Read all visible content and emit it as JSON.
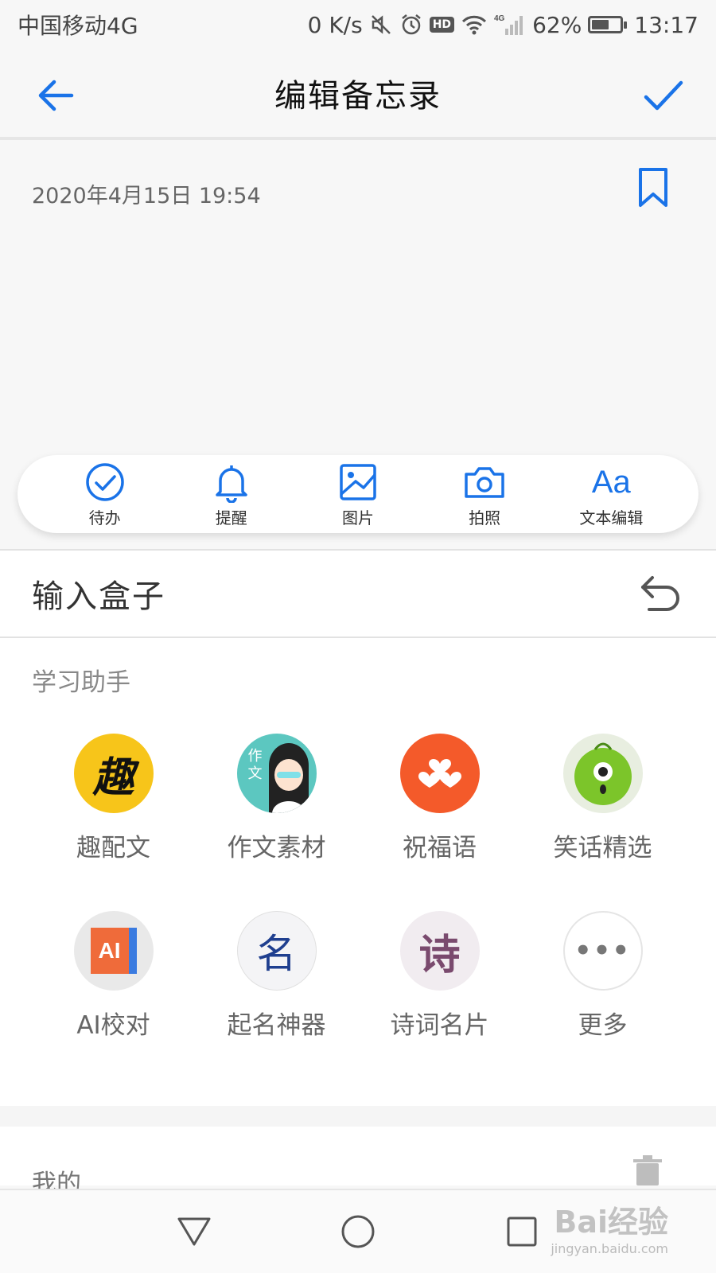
{
  "status_bar": {
    "carrier": "中国移动4G",
    "speed": "0 K/s",
    "hd_badge": "HD",
    "network_badge": "4G",
    "battery_percent": "62%",
    "battery_level": 0.62,
    "time": "13:17"
  },
  "header": {
    "title": "编辑备忘录"
  },
  "note": {
    "date": "2020年4月15日 19:54"
  },
  "toolbar": {
    "items": [
      {
        "label": "待办",
        "icon": "todo-check-icon"
      },
      {
        "label": "提醒",
        "icon": "bell-icon"
      },
      {
        "label": "图片",
        "icon": "image-icon"
      },
      {
        "label": "拍照",
        "icon": "camera-icon"
      },
      {
        "label": "文本编辑",
        "icon": "text-format-icon",
        "glyph": "Aa"
      }
    ]
  },
  "input_box": {
    "title": "输入盒子",
    "section_study": "学习助手",
    "apps_row1": [
      {
        "label": "趣配文",
        "glyph": "趣",
        "color": "#f7c51a"
      },
      {
        "label": "作文素材",
        "glyph": "作文",
        "color": "#5cc7c0"
      },
      {
        "label": "祝福语",
        "glyph": "♥",
        "color": "#f45a2a"
      },
      {
        "label": "笑话精选",
        "glyph": "◉",
        "color": "#7cc52a"
      }
    ],
    "apps_row2": [
      {
        "label": "AI校对",
        "glyph": "AI",
        "color": "#ef6b3a"
      },
      {
        "label": "起名神器",
        "glyph": "名",
        "color": "#1f3f8f"
      },
      {
        "label": "诗词名片",
        "glyph": "诗",
        "color": "#7a4a6e"
      },
      {
        "label": "更多",
        "glyph": "•••",
        "color": "#777777"
      }
    ],
    "section_mine": "我的"
  },
  "watermark": {
    "brand": "Bai经验",
    "url": "jingyan.baidu.com"
  },
  "colors": {
    "accent": "#1a73e8"
  }
}
